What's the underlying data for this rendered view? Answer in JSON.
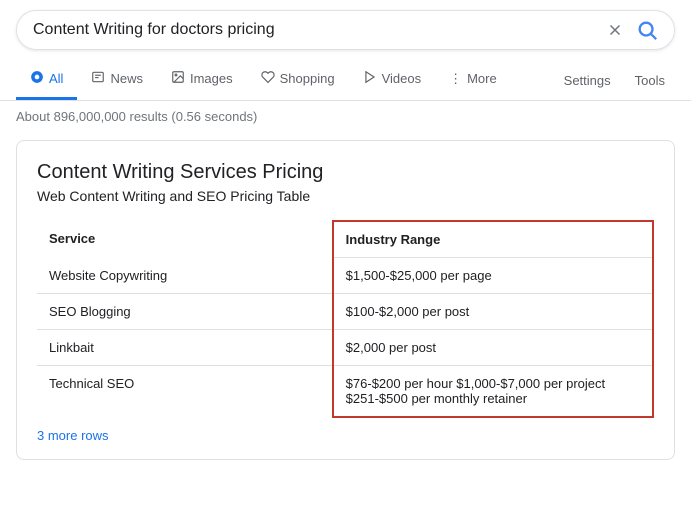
{
  "searchbar": {
    "query": "Content Writing for doctors pricing",
    "clear_label": "×",
    "search_label": "🔍"
  },
  "nav": {
    "tabs": [
      {
        "id": "all",
        "label": "All",
        "icon": "🔍",
        "active": true
      },
      {
        "id": "news",
        "label": "News",
        "icon": "📰",
        "active": false
      },
      {
        "id": "images",
        "label": "Images",
        "icon": "🖼",
        "active": false
      },
      {
        "id": "shopping",
        "label": "Shopping",
        "icon": "🛍",
        "active": false
      },
      {
        "id": "videos",
        "label": "Videos",
        "icon": "▶",
        "active": false
      },
      {
        "id": "more",
        "label": "More",
        "icon": "⋮",
        "active": false
      }
    ],
    "settings": "Settings",
    "tools": "Tools"
  },
  "results_count": "About 896,000,000 results (0.56 seconds)",
  "card": {
    "title": "Content Writing Services Pricing",
    "subtitle": "Web Content Writing and SEO Pricing Table",
    "table": {
      "headers": [
        "Service",
        "Industry Range"
      ],
      "rows": [
        {
          "service": "Website Copywriting",
          "range": "$1,500-$25,000 per page"
        },
        {
          "service": "SEO Blogging",
          "range": "$100-$2,000 per post"
        },
        {
          "service": "Linkbait",
          "range": "$2,000 per post"
        },
        {
          "service": "Technical SEO",
          "range": "$76-$200 per hour $1,000-$7,000 per project $251-$500 per monthly retainer"
        }
      ],
      "more_rows_label": "3 more rows"
    }
  }
}
